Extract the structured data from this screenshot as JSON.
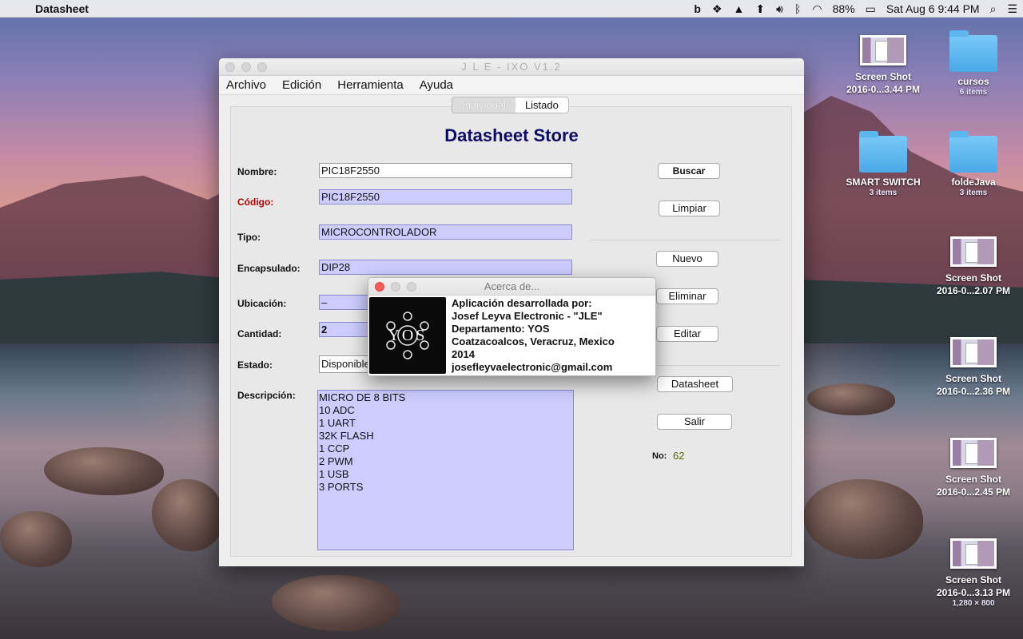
{
  "menubar": {
    "app_name": "Datasheet",
    "battery": "88%",
    "datetime": "Sat Aug 6  9:44 PM"
  },
  "desktop": {
    "icons": [
      {
        "label": "Screen Shot",
        "sub": "2016-0...3.44 PM",
        "kind": "screenshot"
      },
      {
        "label": "cursos",
        "sub": "6 items",
        "kind": "folder"
      },
      {
        "label": "SMART SWITCH",
        "sub": "3 items",
        "kind": "folder"
      },
      {
        "label": "foldeJava",
        "sub": "3 items",
        "kind": "folder"
      },
      {
        "label": "Screen Shot",
        "sub": "2016-0...2.07 PM",
        "kind": "screenshot"
      },
      {
        "label": "Screen Shot",
        "sub": "2016-0...2.36 PM",
        "kind": "screenshot"
      },
      {
        "label": "Screen Shot",
        "sub": "2016-0...2.45 PM",
        "kind": "screenshot"
      },
      {
        "label": "Screen Shot",
        "sub": "2016-0...3.13 PM",
        "dims": "1,280 × 800",
        "kind": "screenshot"
      }
    ]
  },
  "window": {
    "title": "J L E - IXO V1.2",
    "menu": [
      "Archivo",
      "Edición",
      "Herramienta",
      "Ayuda"
    ],
    "tabs": [
      "Individual",
      "Listado"
    ],
    "heading": "Datasheet Store",
    "labels": {
      "nombre": "Nombre:",
      "codigo": "Código:",
      "tipo": "Tipo:",
      "encapsulado": "Encapsulado:",
      "ubicacion": "Ubicación:",
      "cantidad": "Cantidad:",
      "estado": "Estado:",
      "descripcion": "Descripción:"
    },
    "values": {
      "nombre": "PIC18F2550",
      "codigo": "PIC18F2550",
      "tipo": "MICROCONTROLADOR",
      "encapsulado": "DIP28",
      "ubicacion": "–",
      "cantidad": "2",
      "estado": "Disponible"
    },
    "descripcion_lines": [
      "MICRO DE 8 BITS",
      "10 ADC",
      "1 UART",
      "32K FLASH",
      "1 CCP",
      "2 PWM",
      "1 USB",
      "3 PORTS"
    ],
    "buttons": {
      "buscar": "Buscar",
      "limpiar": "Limpiar",
      "nuevo": "Nuevo",
      "eliminar": "Eliminar",
      "editar": "Editar",
      "datasheet": "Datasheet",
      "salir": "Salir"
    },
    "no_label": "No:",
    "no_value": "62"
  },
  "about": {
    "title": "Acerca de...",
    "logo_text": "YOS",
    "lines": [
      "Aplicación desarrollada por:",
      "Josef Leyva Electronic - \"JLE\"",
      "Departamento: YOS",
      "Coatzacoalcos, Veracruz, Mexico",
      "2014",
      "josefleyvaelectronic@gmail.com"
    ]
  }
}
